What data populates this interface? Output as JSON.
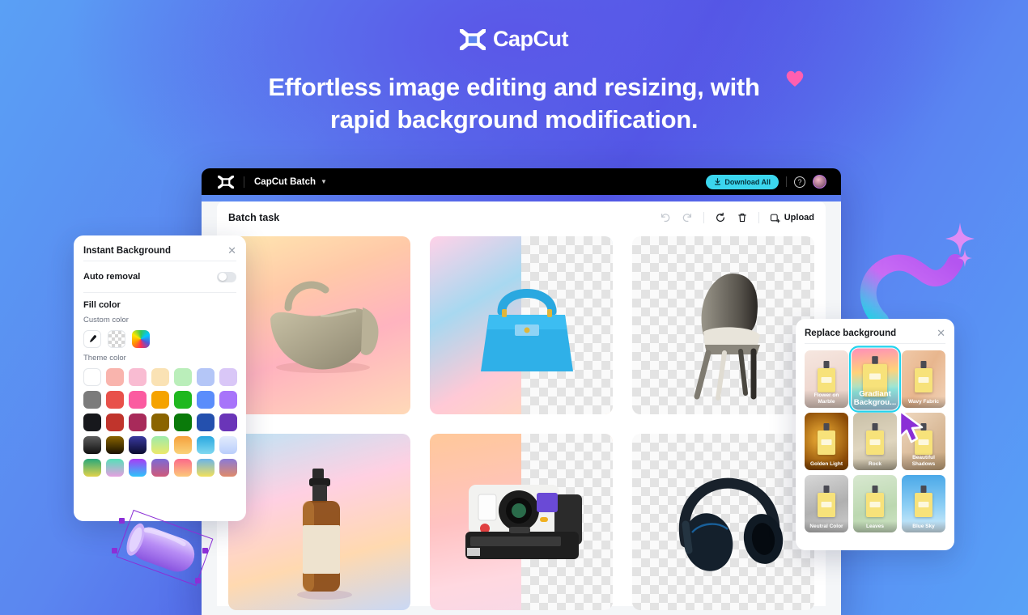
{
  "brand": {
    "name": "CapCut",
    "logo_icon": "capcut-logo-icon"
  },
  "hero": {
    "headline_line1": "Effortless image editing and resizing, with",
    "headline_line2": "rapid background modification.",
    "heart_icon": "heart-icon",
    "sparkle_icon": "sparkle-icon"
  },
  "app": {
    "topbar": {
      "logo_icon": "capcut-logo-icon",
      "project_name": "CapCut Batch",
      "chevron_icon": "chevron-down-icon",
      "download_all_label": "Download All",
      "download_icon": "download-icon",
      "help_icon": "help-icon",
      "help_glyph": "?",
      "avatar_icon": "avatar"
    },
    "toolbar": {
      "title": "Batch task",
      "undo_icon": "undo-icon",
      "redo_icon": "redo-icon",
      "refresh_icon": "refresh-icon",
      "delete_icon": "trash-icon",
      "upload_label": "Upload",
      "upload_icon": "upload-icon"
    },
    "grid": [
      {
        "name": "handbag-beige",
        "background": "gradient",
        "split": false
      },
      {
        "name": "handbag-blue",
        "background": "gradient",
        "split": true
      },
      {
        "name": "chair",
        "background": "transparent",
        "split": false
      },
      {
        "name": "spray-bottle",
        "background": "gradient",
        "split": false
      },
      {
        "name": "instant-camera",
        "background": "gradient",
        "split": true
      },
      {
        "name": "headphones",
        "background": "transparent",
        "split": false
      }
    ]
  },
  "instant_background": {
    "title": "Instant Background",
    "close_icon": "close-icon",
    "auto_removal_label": "Auto removal",
    "auto_removal_on": false,
    "fill_color_label": "Fill color",
    "custom_color_label": "Custom color",
    "custom_swatches": [
      "eyedropper-icon",
      "transparent-swatch",
      "rainbow-swatch"
    ],
    "theme_color_label": "Theme color",
    "theme_colors": [
      [
        "#ffffff",
        "#f9b4ad",
        "#f9bcd2",
        "#fae2b4",
        "#baeeba",
        "#b4c6f7",
        "#d9c7f7"
      ],
      [
        "#7b7b7b",
        "#e8514a",
        "#fb5ba0",
        "#f5a300",
        "#1fb81f",
        "#5b8dfb",
        "#a774fa"
      ],
      [
        "#17181c",
        "#c0342c",
        "#a82a5a",
        "#8a6400",
        "#0a7a0a",
        "#2450ae",
        "#6a35b8"
      ],
      [
        "#3a3a3a",
        "#6b4a00",
        "#1b1b5a",
        "#9cebab",
        "#f5a03c",
        "#2aa8e0",
        "#c3d6fb"
      ],
      [
        "#2aa87a",
        "#55e0b8",
        "#a73cf5",
        "#7a6ad6",
        "#fb6a8a",
        "#6ab4e8",
        "#8a7ad6"
      ]
    ]
  },
  "replace_background": {
    "title": "Replace background",
    "close_icon": "close-icon",
    "cursor_icon": "cursor-arrow-icon",
    "thumbnails": [
      {
        "label": "Flower on Marble",
        "selected": false
      },
      {
        "label": "Gradiant Backgrou...",
        "selected": true
      },
      {
        "label": "Wavy Fabric",
        "selected": false
      },
      {
        "label": "Golden Light",
        "selected": false
      },
      {
        "label": "Rock",
        "selected": false
      },
      {
        "label": "Beautiful Shadows",
        "selected": false
      },
      {
        "label": "Neutral Color",
        "selected": false
      },
      {
        "label": "Leaves",
        "selected": false
      },
      {
        "label": "Blue Sky",
        "selected": false
      }
    ]
  },
  "decor": {
    "cylinder_name": "purple-cylinder-object",
    "ribbon_name": "gradient-ribbon-decoration"
  },
  "colors": {
    "accent_cyan": "#3bd6ee",
    "selection_purple": "#8b2fd6",
    "heart_pink": "#ff5fb0",
    "bg_blue": "#5a86f0",
    "bg_indigo": "#4f56e4"
  }
}
